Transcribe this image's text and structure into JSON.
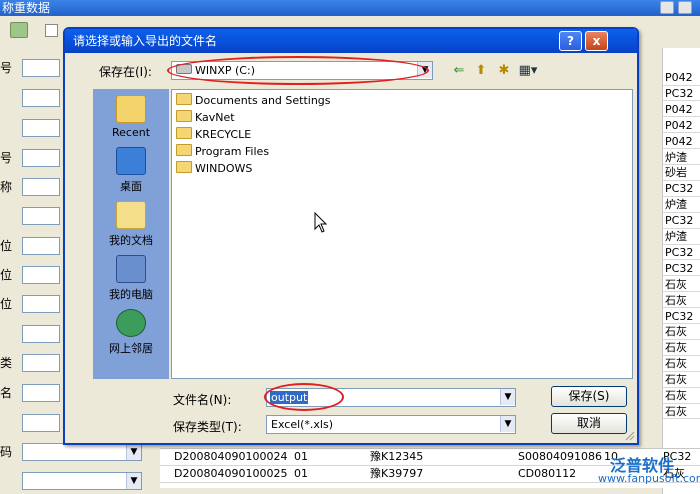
{
  "bg_window": {
    "title": "称重数据",
    "left_labels": [
      "号",
      "号",
      "称",
      "位",
      "位",
      "位",
      "类",
      "名",
      "码"
    ],
    "right_column": [
      "P042",
      "PC32",
      "P042",
      "P042",
      "P042",
      "炉渣",
      "砂岩",
      "PC32",
      "炉渣",
      "PC32",
      "炉渣",
      "PC32",
      "PC32",
      "石灰",
      "石灰",
      "PC32",
      "石灰",
      "石灰",
      "石灰",
      "石灰",
      "石灰",
      "石灰"
    ],
    "rows": [
      {
        "id": "D200804090100024",
        "no": "01",
        "plate": "豫K12345",
        "code": "S00804091086",
        "val": "10",
        "tail": "PC32"
      },
      {
        "id": "D200804090100025",
        "no": "01",
        "plate": "豫K39797",
        "code": "CD080112",
        "val": "",
        "tail": "石灰"
      }
    ]
  },
  "dialog": {
    "title": "请选择或输入导出的文件名",
    "help": "?",
    "close": "x",
    "save_in_label": "保存在(I):",
    "save_in_value": "WINXP (C:)",
    "places": [
      {
        "label": "Recent"
      },
      {
        "label": "桌面"
      },
      {
        "label": "我的文档"
      },
      {
        "label": "我的电脑"
      },
      {
        "label": "网上邻居"
      }
    ],
    "files": [
      "Documents and Settings",
      "KavNet",
      "KRECYCLE",
      "Program Files",
      "WINDOWS"
    ],
    "filename_label": "文件名(N):",
    "filename_value": "output",
    "filetype_label": "保存类型(T):",
    "filetype_value": "Excel(*.xls)",
    "save_button": "保存(S)",
    "cancel_button": "取消"
  },
  "watermark": {
    "brand": "泛普软件",
    "url": "www.fanpusoft.com"
  }
}
